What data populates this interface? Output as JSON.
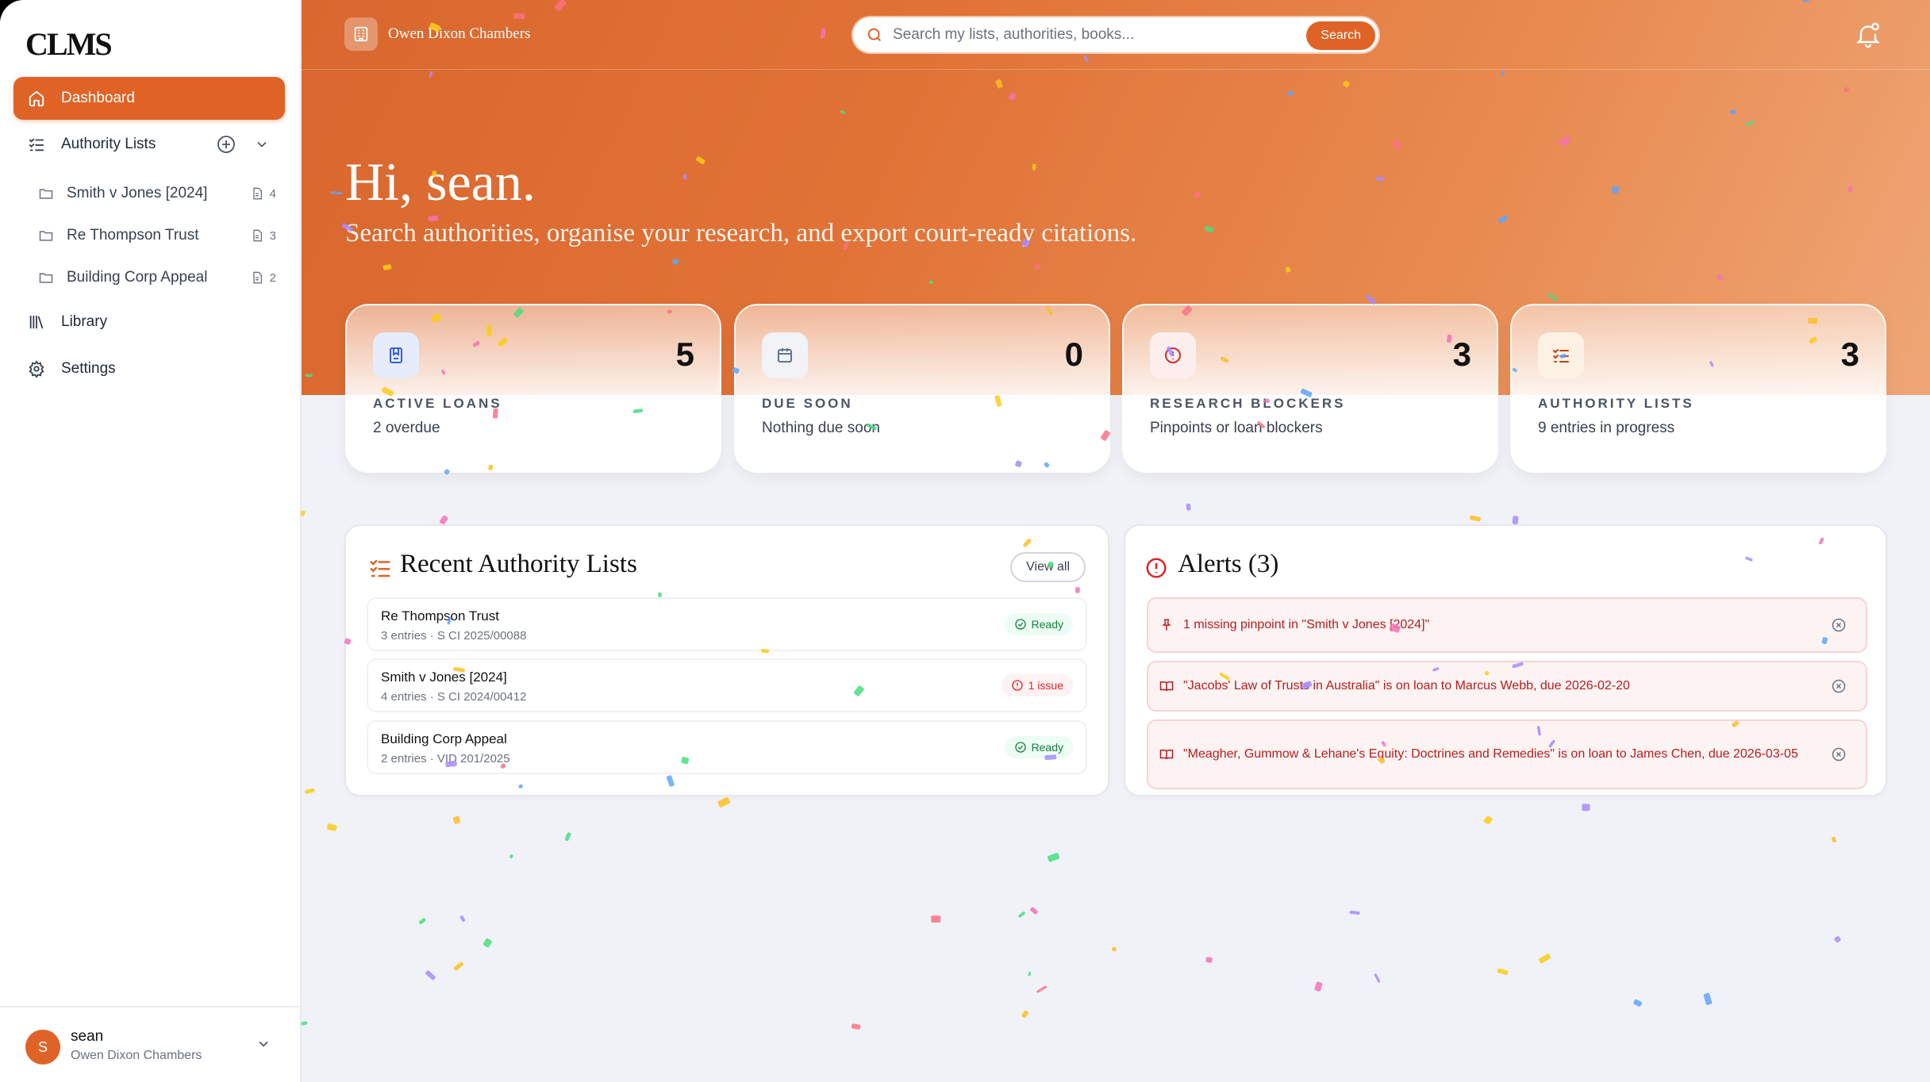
{
  "app": {
    "logo": "CLMS"
  },
  "sidebar": {
    "items": [
      {
        "label": "Dashboard",
        "icon": "home-icon"
      },
      {
        "label": "Authority Lists",
        "icon": "list-check-icon"
      },
      {
        "label": "Library",
        "icon": "library-icon"
      },
      {
        "label": "Settings",
        "icon": "gear-icon"
      }
    ],
    "lists": [
      {
        "label": "Smith v Jones [2024]",
        "count": "4"
      },
      {
        "label": "Re Thompson Trust",
        "count": "3"
      },
      {
        "label": "Building Corp Appeal",
        "count": "2"
      }
    ],
    "user": {
      "initial": "S",
      "name": "sean",
      "org": "Owen Dixon Chambers"
    }
  },
  "header": {
    "org": "Owen Dixon Chambers",
    "search_placeholder": "Search my lists, authorities, books...",
    "search_button": "Search"
  },
  "hero": {
    "greeting": "Hi, sean.",
    "tagline": "Search authorities, organise your research, and export court-ready citations."
  },
  "stats": [
    {
      "value": "5",
      "label": "ACTIVE LOANS",
      "sub": "2 overdue",
      "color": "#3b5bdb",
      "bg": "#e6ecfb"
    },
    {
      "value": "0",
      "label": "DUE SOON",
      "sub": "Nothing due soon",
      "color": "#64748b",
      "bg": "#f1f3f7"
    },
    {
      "value": "3",
      "label": "RESEARCH BLOCKERS",
      "sub": "Pinpoints or loan blockers",
      "color": "#dc2626",
      "bg": "#fdeeee"
    },
    {
      "value": "3",
      "label": "AUTHORITY LISTS",
      "sub": "9 entries in progress",
      "color": "#c2410c",
      "bg": "#fdf1e4"
    }
  ],
  "recent": {
    "title": "Recent Authority Lists",
    "view_all": "View all",
    "rows": [
      {
        "title": "Re Thompson Trust",
        "sub": "3 entries · S CI 2025/00088",
        "status": "Ready"
      },
      {
        "title": "Smith v Jones [2024]",
        "sub": "4 entries · S CI 2024/00412",
        "status": "1 issue"
      },
      {
        "title": "Building Corp Appeal",
        "sub": "2 entries · VID 201/2025",
        "status": "Ready"
      }
    ]
  },
  "alerts": {
    "title": "Alerts (3)",
    "items": [
      {
        "text": "1 missing pinpoint in \"Smith v Jones [2024]\"",
        "icon": "pin-icon"
      },
      {
        "text": "\"Jacobs' Law of Trusts in Australia\" is on loan to Marcus Webb, due 2026-02-20",
        "icon": "book-icon"
      },
      {
        "text": "\"Meagher, Gummow & Lehane's Equity: Doctrines and Remedies\" is on loan to James Chen, due 2026-03-05",
        "icon": "book-icon"
      }
    ]
  }
}
